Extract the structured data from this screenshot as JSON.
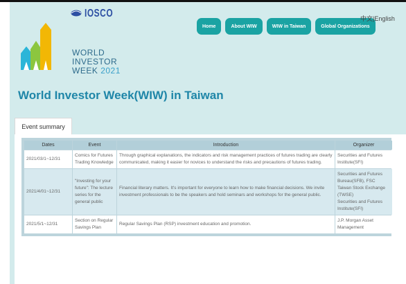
{
  "brand": {
    "org_name": "IOSCO",
    "wiw_line1": "WORLD",
    "wiw_line2": "INVESTOR",
    "wiw_line3_word": "WEEK",
    "wiw_line3_year": "2021"
  },
  "nav": {
    "items": [
      {
        "label": "Home"
      },
      {
        "label": "About WIW"
      },
      {
        "label": "WIW in Taiwan"
      },
      {
        "label": "Global Organizations"
      }
    ]
  },
  "lang": {
    "zh": "中文",
    "sep": "|",
    "en": "English"
  },
  "page_title": "World Investor Week(WIW) in Taiwan",
  "tab": {
    "label": "Event summary"
  },
  "table": {
    "headers": {
      "dates": "Dates",
      "event": "Event",
      "intro": "Introduction",
      "organizer": "Organizer"
    },
    "rows": [
      {
        "dates": "2021/03/1~12/31",
        "event": "Comics for Futures Trading Knowledge",
        "intro": "Through graphical explanations, the indicators and risk management practices of futures trading are clearly communicated, making it easier for novices to understand the risks and precautions of futures trading.",
        "organizer_1": "Securities and Futures Institute(SFI)"
      },
      {
        "dates": "2021/4/01~12/31",
        "event": "\"Investing for your future\": The lecture series for the general public",
        "intro": "Financial literary matters. It's important for everyone to learn how to make financial decisions. We invite investment professionals to be the speakers and hold seminars and workshops for the general public.",
        "organizer_1": "Securities and Futures Bureau(SFB), FSC",
        "organizer_2": "Taiwan Stock Exchange (TWSE)",
        "organizer_3": "Securities and Futures Institute(SFI)"
      },
      {
        "dates": "2021/5/1~12/31",
        "event": "Section on Regular Savings Plan",
        "intro": "Regular Savings Plan (RSP) investment education and promotion.",
        "organizer_1": "J.P. Morgan Asset Management"
      }
    ]
  }
}
